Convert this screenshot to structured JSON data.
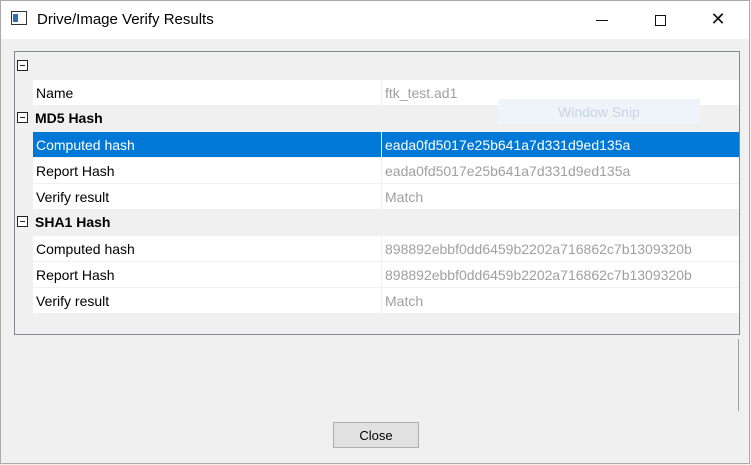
{
  "window": {
    "title": "Drive/Image Verify Results",
    "close_glyph": "✕"
  },
  "root": {
    "name_label": "Name",
    "name_value": "ftk_test.ad1"
  },
  "md5": {
    "category": "MD5 Hash",
    "computed_label": "Computed hash",
    "computed_value": "eada0fd5017e25b641a7d331d9ed135a",
    "report_label": "Report Hash",
    "report_value": "eada0fd5017e25b641a7d331d9ed135a",
    "verify_label": "Verify result",
    "verify_value": "Match"
  },
  "sha1": {
    "category": "SHA1 Hash",
    "computed_label": "Computed hash",
    "computed_value": "898892ebbf0dd6459b2202a716862c7b1309320b",
    "report_label": "Report Hash",
    "report_value": "898892ebbf0dd6459b2202a716862c7b1309320b",
    "verify_label": "Verify result",
    "verify_value": "Match"
  },
  "overlay": {
    "ghost_text": "Window Snip"
  },
  "footer": {
    "close_label": "Close"
  },
  "colors": {
    "selection": "#0078d7",
    "value_text": "#a0a0a0"
  }
}
